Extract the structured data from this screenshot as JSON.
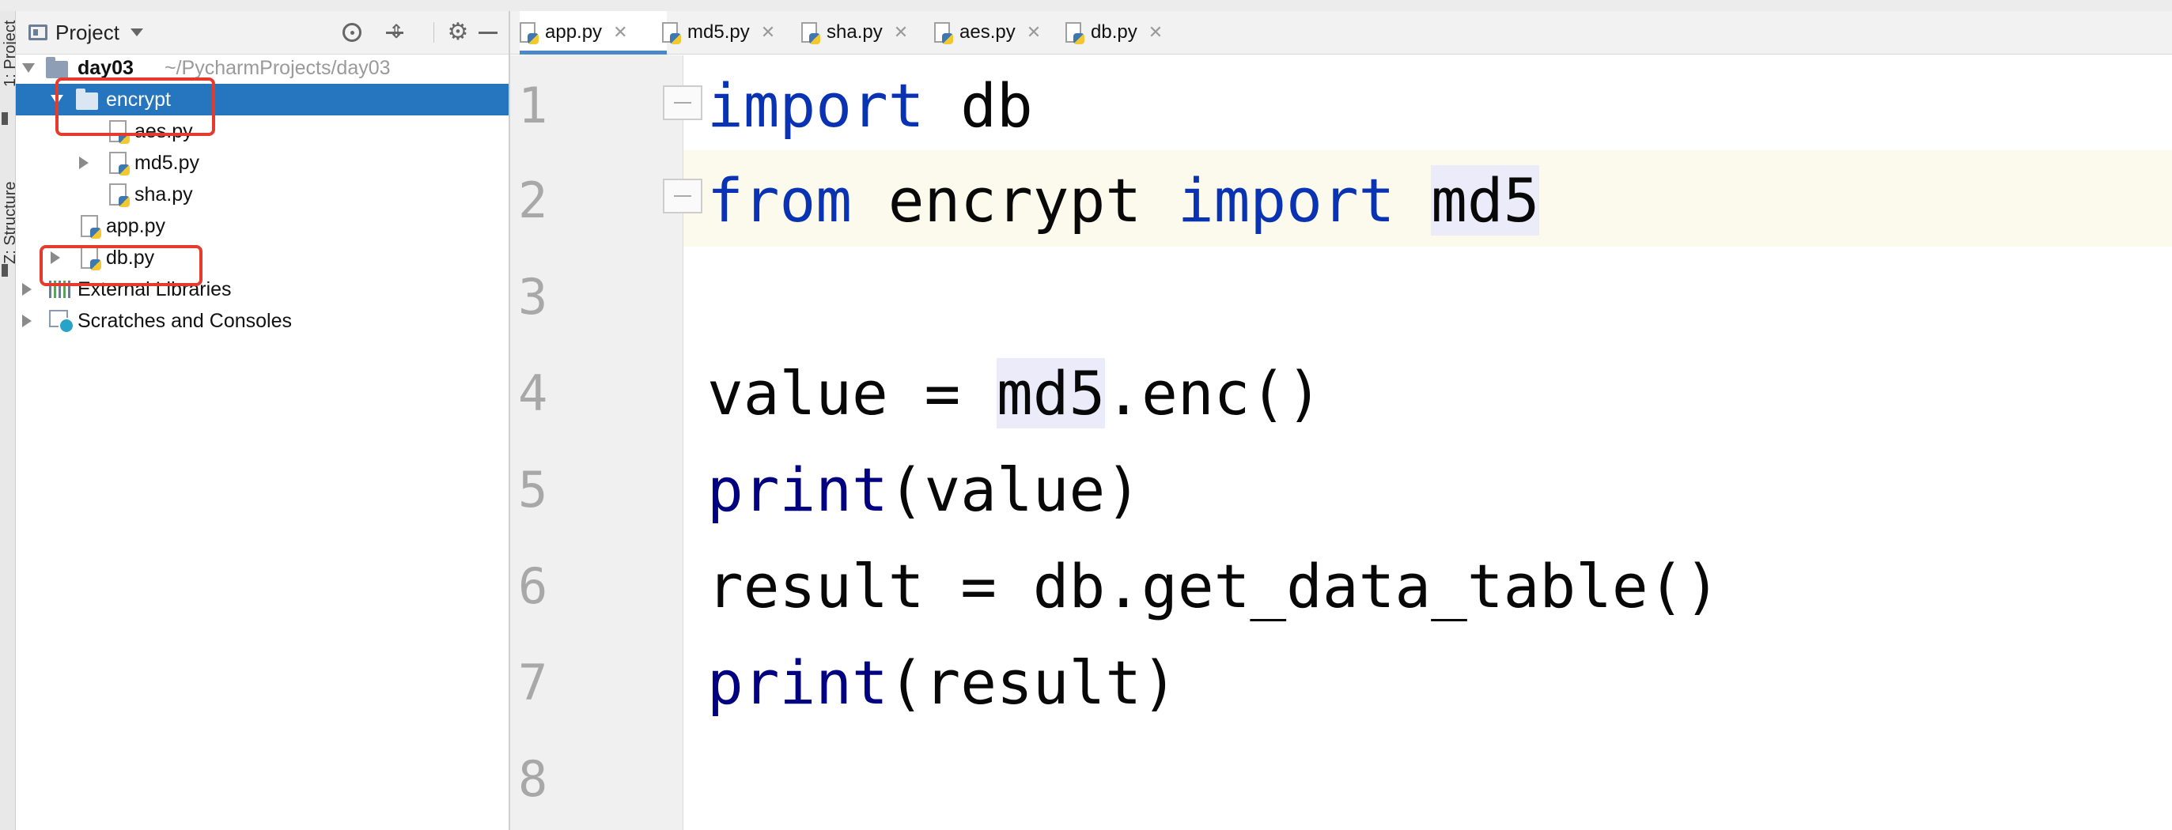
{
  "sidebar_tabs": [
    "1: Project",
    "Z: Structure"
  ],
  "project_panel": {
    "title": "Project",
    "tree": {
      "root": {
        "name": "day03",
        "path": "~/PycharmProjects/day03"
      },
      "encrypt_folder": "encrypt",
      "aes_file": "aes.py",
      "md5_file": "md5.py",
      "sha_file": "sha.py",
      "app_file": "app.py",
      "db_file": "db.py",
      "external_libraries": "External Libraries",
      "scratches": "Scratches and Consoles"
    }
  },
  "tabs": [
    {
      "label": "app.py",
      "active": true
    },
    {
      "label": "md5.py",
      "active": false
    },
    {
      "label": "sha.py",
      "active": false
    },
    {
      "label": "aes.py",
      "active": false
    },
    {
      "label": "db.py",
      "active": false
    }
  ],
  "editor": {
    "line_numbers": [
      "1",
      "2",
      "3",
      "4",
      "5",
      "6",
      "7",
      "8"
    ],
    "code": {
      "l1": {
        "kw1": "import",
        "rest": " db"
      },
      "l2": {
        "kw1": "from",
        "mid": " encrypt ",
        "kw2": "import",
        "sp": " ",
        "name": "md5"
      },
      "l4": {
        "pre": "value = ",
        "name": "md5",
        "post": ".enc()"
      },
      "l5": {
        "fn": "print",
        "post": "(value)"
      },
      "l6": {
        "text": "result = db.get_data_table()"
      },
      "l7": {
        "fn": "print",
        "post": "(result)"
      }
    }
  },
  "colors": {
    "keyword": "#0a33b3",
    "builtin": "#000080",
    "selection": "#2675bf",
    "annotation_box": "#e53b2f",
    "caret_line": "#fcfaed"
  }
}
